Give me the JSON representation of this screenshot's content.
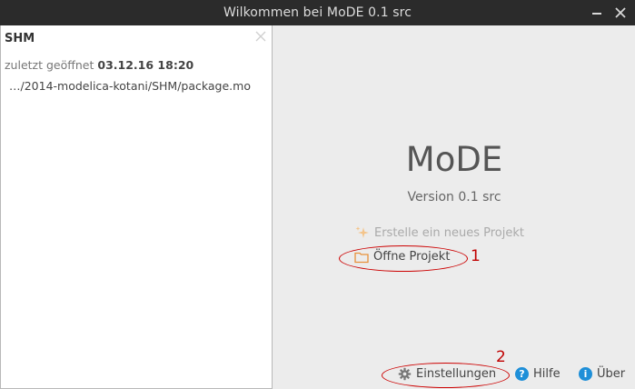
{
  "window": {
    "title": "Wilkommen bei MoDE 0.1 src"
  },
  "sidebar": {
    "recent_projects": [
      {
        "name": "SHM",
        "opened_label": "zuletzt geöffnet",
        "opened_date": "03.12.16 18:20",
        "path": "…/2014-modelica-kotani/SHM/package.mo"
      }
    ]
  },
  "main": {
    "app_name": "MoDE",
    "version": "Version 0.1 src",
    "actions": {
      "new_project": "Erstelle ein neues Projekt",
      "open_project": "Öffne Projekt"
    },
    "bottom": {
      "settings": "Einstellungen",
      "help": "Hilfe",
      "about": "Über"
    }
  },
  "annotations": {
    "marker_1": "1",
    "marker_2": "2"
  },
  "icons": {
    "new_project": "sparkle-icon",
    "open_project": "folder-icon",
    "settings": "gear-icon",
    "help": "question-circle-icon",
    "about": "info-circle-icon"
  },
  "colors": {
    "titlebar": "#2b2b2b",
    "accent_icon": "#f0a040",
    "annotation": "#cc0000",
    "help_info_blue": "#1e8fd8"
  }
}
